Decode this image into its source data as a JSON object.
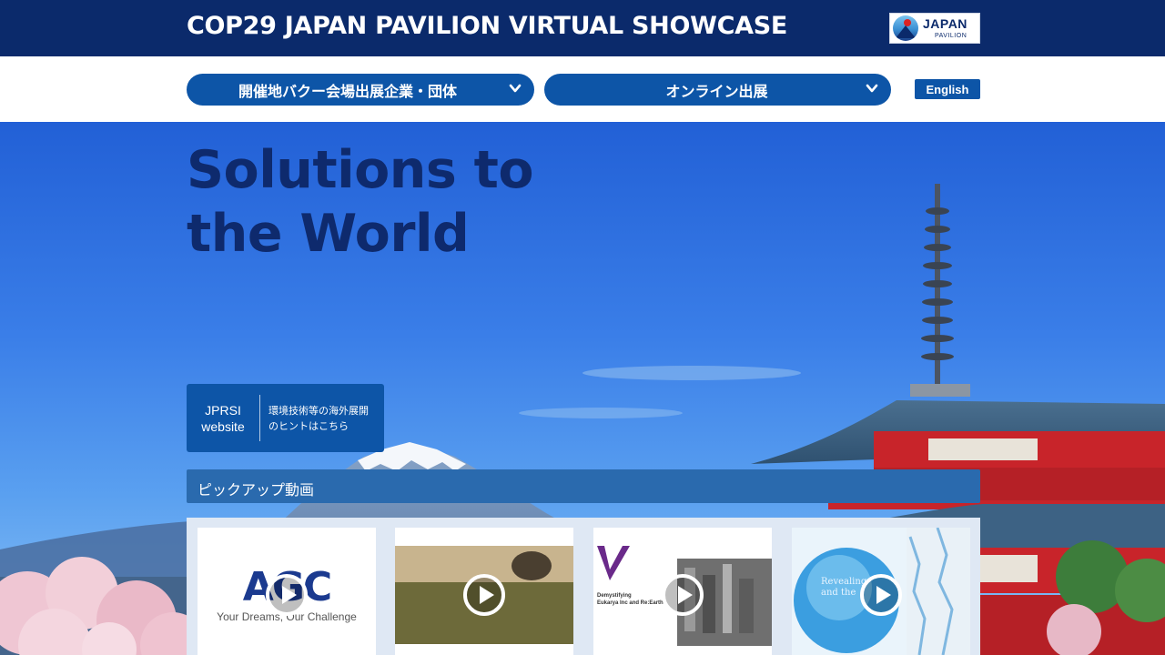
{
  "header": {
    "title": "COP29 JAPAN PAVILION VIRTUAL SHOWCASE",
    "logo": {
      "word": "JAPAN",
      "sub": "PAVILION"
    }
  },
  "nav": {
    "dropdown_1": "開催地バクー会場出展企業・団体",
    "dropdown_2": "オンライン出展",
    "language_button": "English"
  },
  "hero": {
    "title_line1": "Solutions to",
    "title_line2": "the World"
  },
  "jprsi": {
    "label_line1": "JPRSI",
    "label_line2": "website",
    "desc_line1": "環境技術等の海外展開",
    "desc_line2": "のヒントはこちら"
  },
  "pickup": {
    "title": "ピックアップ動画",
    "videos": [
      {
        "logo": "AGC",
        "tagline": "Your Dreams, Our Challenge"
      },
      {},
      {
        "line1": "Demystifying",
        "line2": "Eukarya Inc and Re:Earth"
      },
      {
        "line1": "Revealing",
        "line2": "and the"
      }
    ]
  },
  "colors": {
    "header_bg": "#0b2a6b",
    "button_blue": "#0d55a7",
    "pickup_bar": "#2a6aae",
    "hero_title": "#0e2a6d"
  }
}
